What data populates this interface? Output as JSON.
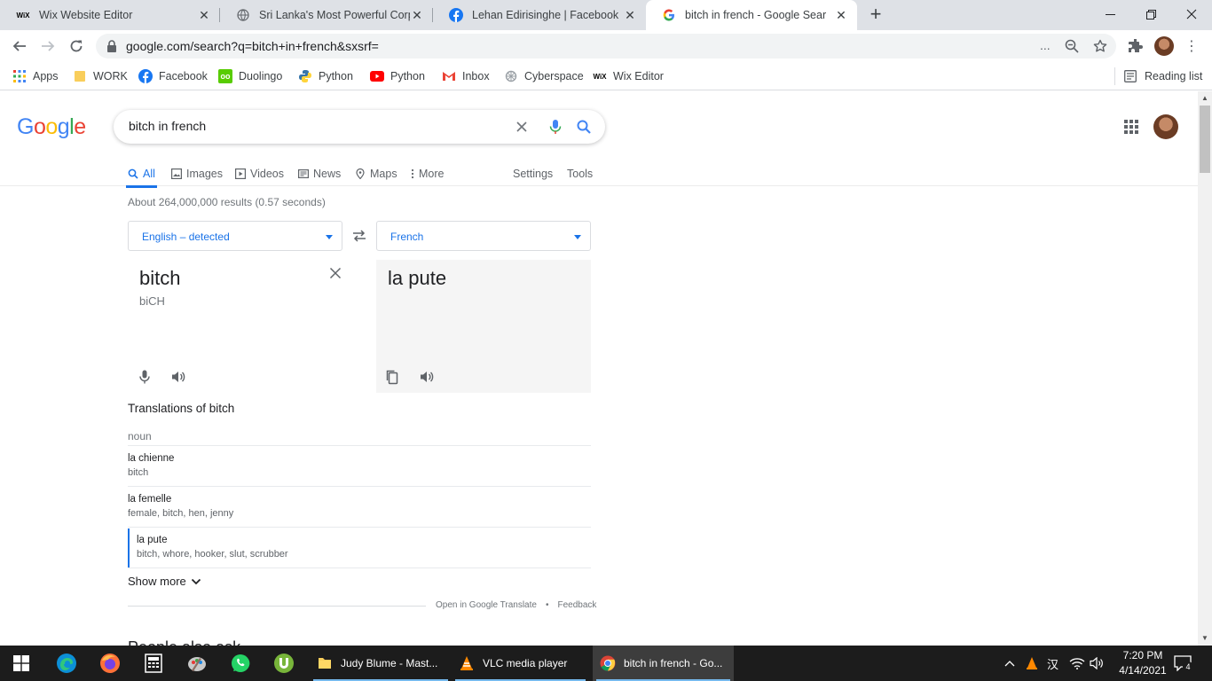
{
  "browser": {
    "tabs": [
      {
        "title": "Wix Website Editor",
        "icon": "wix-icon",
        "active": false
      },
      {
        "title": "Sri Lanka's Most Powerful Corpo",
        "icon": "globe-icon",
        "active": false
      },
      {
        "title": "Lehan Edirisinghe | Facebook",
        "icon": "facebook-icon",
        "active": false
      },
      {
        "title": "bitch in french - Google Sear",
        "icon": "google-icon",
        "active": true
      }
    ],
    "url": "google.com/search?q=bitch+in+french&sxsrf=",
    "url_overflow": "...",
    "bookmarks": [
      {
        "label": "Apps",
        "icon": "apps-grid-icon",
        "color": "#4285f4"
      },
      {
        "label": "WORK",
        "icon": "folder-icon",
        "color": "#f9ce5b"
      },
      {
        "label": "Facebook",
        "icon": "facebook-icon",
        "color": "#1877f2"
      },
      {
        "label": "Duolingo",
        "icon": "duolingo-icon",
        "color": "#58cc02"
      },
      {
        "label": "Python",
        "icon": "python-icon",
        "color": "#3776ab"
      },
      {
        "label": "Python",
        "icon": "youtube-icon",
        "color": "#ff0000"
      },
      {
        "label": "Inbox",
        "icon": "gmail-icon",
        "color": "#ea4335"
      },
      {
        "label": "Cyberspace",
        "icon": "cyberspace-icon",
        "color": "#9aa0a6"
      },
      {
        "label": "Wix Editor",
        "icon": "wix-icon",
        "color": "#000000"
      }
    ],
    "reading_list": "Reading list"
  },
  "google": {
    "logo": "Google",
    "query": "bitch in french",
    "tabs": [
      {
        "label": "All",
        "icon": "search-icon"
      },
      {
        "label": "Images",
        "icon": "image-icon"
      },
      {
        "label": "Videos",
        "icon": "video-icon"
      },
      {
        "label": "News",
        "icon": "news-icon"
      },
      {
        "label": "Maps",
        "icon": "map-pin-icon"
      },
      {
        "label": "More",
        "icon": "more-vert-icon"
      }
    ],
    "settings": "Settings",
    "tools": "Tools",
    "stats": "About 264,000,000 results (0.57 seconds)"
  },
  "translate": {
    "source_lang": "English – detected",
    "target_lang": "French",
    "source_word": "bitch",
    "phonetic": "biCH",
    "target_word": "la pute",
    "section_title": "Translations of bitch",
    "part_of_speech": "noun",
    "rows": [
      {
        "word": "la chienne",
        "synonyms": "bitch"
      },
      {
        "word": "la femelle",
        "synonyms": "female, bitch, hen, jenny"
      },
      {
        "word": "la pute",
        "synonyms": "bitch, whore, hooker, slut, scrubber"
      }
    ],
    "show_more": "Show more",
    "open_in_translate": "Open in Google Translate",
    "bullet": "•",
    "feedback": "Feedback"
  },
  "next_section": "People also ask",
  "taskbar": {
    "apps": [
      {
        "label": "Judy Blume - Mast...",
        "icon": "file-explorer-icon"
      },
      {
        "label": "VLC media player",
        "icon": "vlc-icon"
      },
      {
        "label": "bitch in french - Go...",
        "icon": "chrome-icon"
      }
    ],
    "ime": "汉",
    "time": "7:20 PM",
    "date": "4/14/2021",
    "notifications": "4"
  },
  "colors": {
    "accent": "#1a73e8",
    "taskbar": "#1c1c1c"
  }
}
